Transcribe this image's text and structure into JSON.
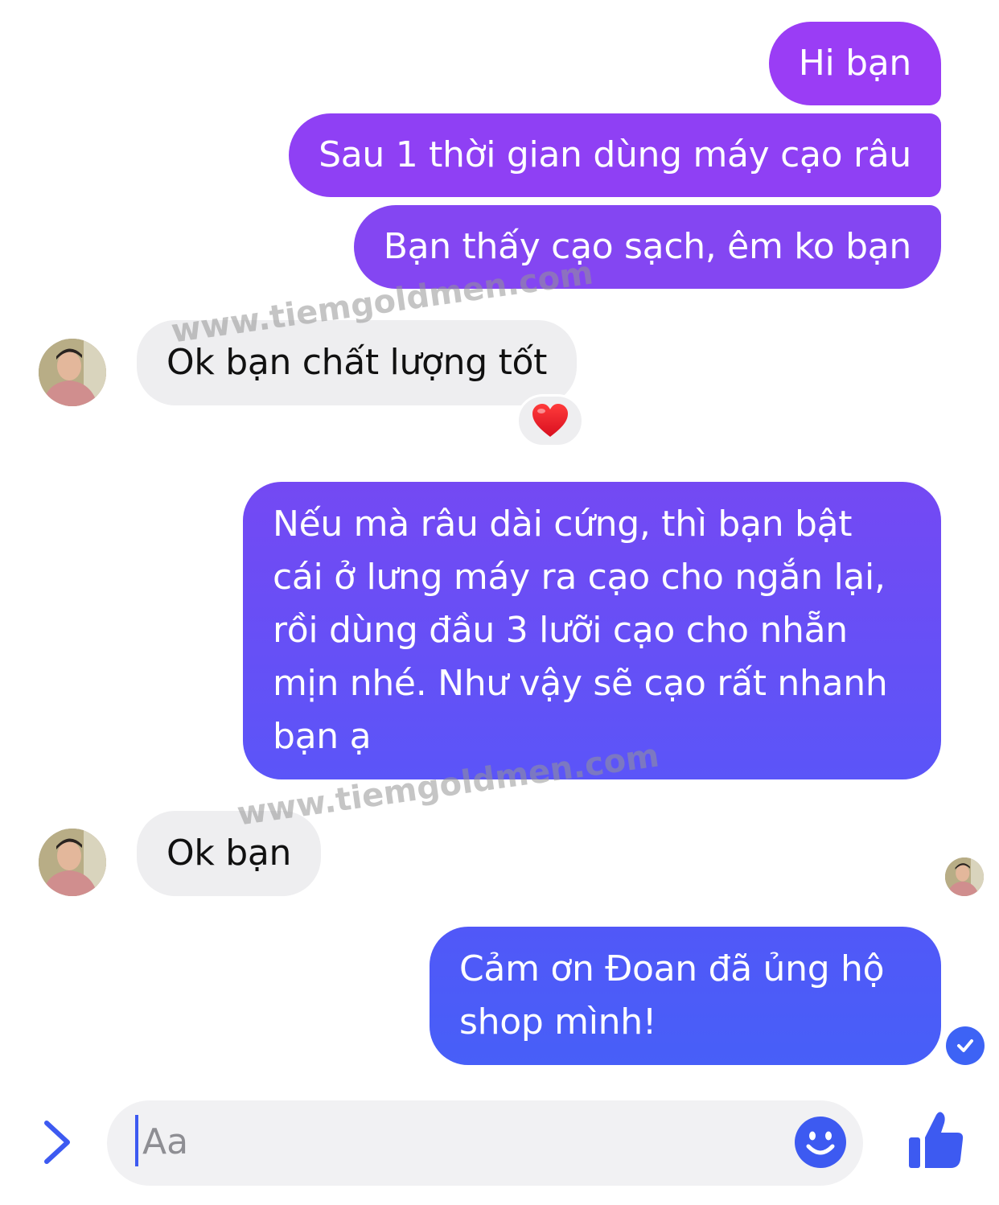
{
  "messages": {
    "m1": "Hi bạn",
    "m2": "Sau 1 thời gian dùng máy cạo râu",
    "m3": "Bạn thấy cạo sạch, êm ko bạn",
    "m4": "Ok bạn chất lượng tốt",
    "m5": "Nếu mà râu dài cứng, thì bạn bật cái ở lưng máy ra cạo cho ngắn lại, rồi dùng đầu 3 lưỡi cạo cho nhẵn mịn nhé. Như vậy sẽ cạo rất nhanh bạn ạ",
    "m6": "Ok bạn",
    "m7": "Cảm ơn Đoan đã ủng hộ shop mình!"
  },
  "reaction": {
    "emoji": "❤️",
    "icon": "heart-icon"
  },
  "watermark": {
    "text": "www.tiemgoldmen.com"
  },
  "composer": {
    "placeholder": "Aa",
    "expand_icon": "chevron-right-icon",
    "emoji_icon": "smiley-icon",
    "like_icon": "thumbs-up-icon"
  },
  "status": {
    "seen_icon": "seen-avatar",
    "sent_icon": "check-circle-icon"
  },
  "colors": {
    "outgoing_top": "#9a3df5",
    "outgoing_bottom": "#475ff8",
    "incoming": "#eeeef0",
    "accent": "#3d5af1"
  }
}
